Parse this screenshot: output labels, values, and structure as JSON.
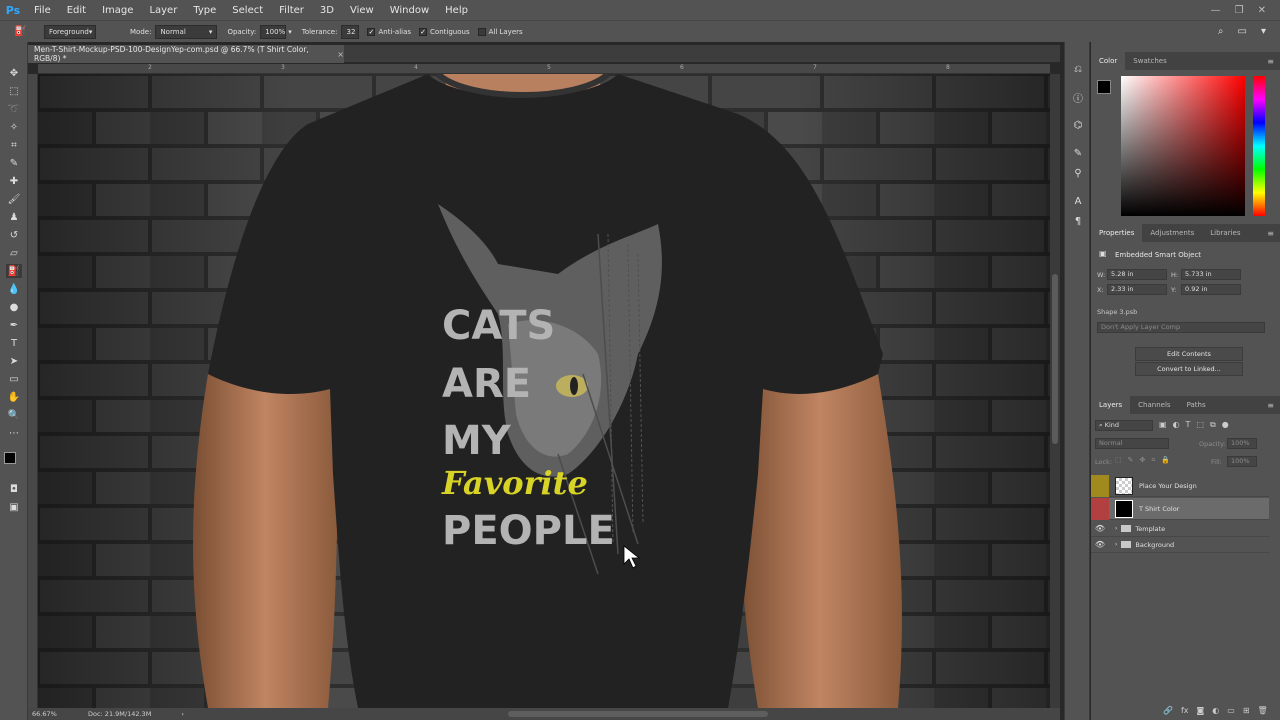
{
  "app": {
    "logo": "Ps",
    "menu": [
      "File",
      "Edit",
      "Image",
      "Layer",
      "Type",
      "Select",
      "Filter",
      "3D",
      "View",
      "Window",
      "Help"
    ],
    "window_controls": [
      "minimize-icon",
      "restore-icon",
      "close-icon"
    ]
  },
  "options_bar": {
    "preset": "Foreground",
    "mode_label": "Mode:",
    "mode_value": "Normal",
    "opacity_label": "Opacity:",
    "opacity_value": "100%",
    "tolerance_label": "Tolerance:",
    "tolerance_value": "32",
    "anti_alias_label": "Anti-alias",
    "contiguous_label": "Contiguous",
    "all_layers_label": "All Layers"
  },
  "document": {
    "tab_title": "Men-T-Shirt-Mockup-PSD-100-DesignYep-com.psd @ 66.7% (T Shirt Color, RGB/8) *",
    "tab_close": "×",
    "ruler_ticks": [
      "2",
      "3",
      "4",
      "5",
      "6",
      "7",
      "8"
    ],
    "artwork_text": {
      "line1": "CATS",
      "line2": "ARE",
      "line3": "MY",
      "line4": "Favorite",
      "line5": "PEOPLE"
    }
  },
  "status_bar": {
    "zoom": "66.67%",
    "doc_info": "Doc: 21.9M/142.3M"
  },
  "color_panel": {
    "tabs": [
      "Color",
      "Swatches"
    ],
    "foreground": "#000000",
    "background": "#ffffff",
    "hue_color": "#ff0000"
  },
  "properties_panel": {
    "tabs": [
      "Properties",
      "Adjustments",
      "Libraries"
    ],
    "object_type": "Embedded Smart Object",
    "w_label": "W:",
    "w_value": "5.28 in",
    "h_label": "H:",
    "h_value": "5.733 in",
    "x_label": "X:",
    "x_value": "2.33 in",
    "y_label": "Y:",
    "y_value": "0.92 in",
    "source_file": "Shape 3.psb",
    "layer_comp": "Don't Apply Layer Comp",
    "edit_contents": "Edit Contents",
    "convert_linked": "Convert to Linked..."
  },
  "layers_panel": {
    "tabs": [
      "Layers",
      "Channels",
      "Paths"
    ],
    "filter_kind": "Kind",
    "blend_mode": "Normal",
    "opacity_label": "Opacity:",
    "opacity_value": "100%",
    "lock_label": "Lock:",
    "fill_label": "Fill:",
    "fill_value": "100%",
    "layers": [
      {
        "name": "Place Your Design",
        "color": "#a08a1e"
      },
      {
        "name": "T Shirt Color",
        "color": "#b24040"
      },
      {
        "name": "Template",
        "color": ""
      },
      {
        "name": "Background",
        "color": ""
      }
    ]
  }
}
